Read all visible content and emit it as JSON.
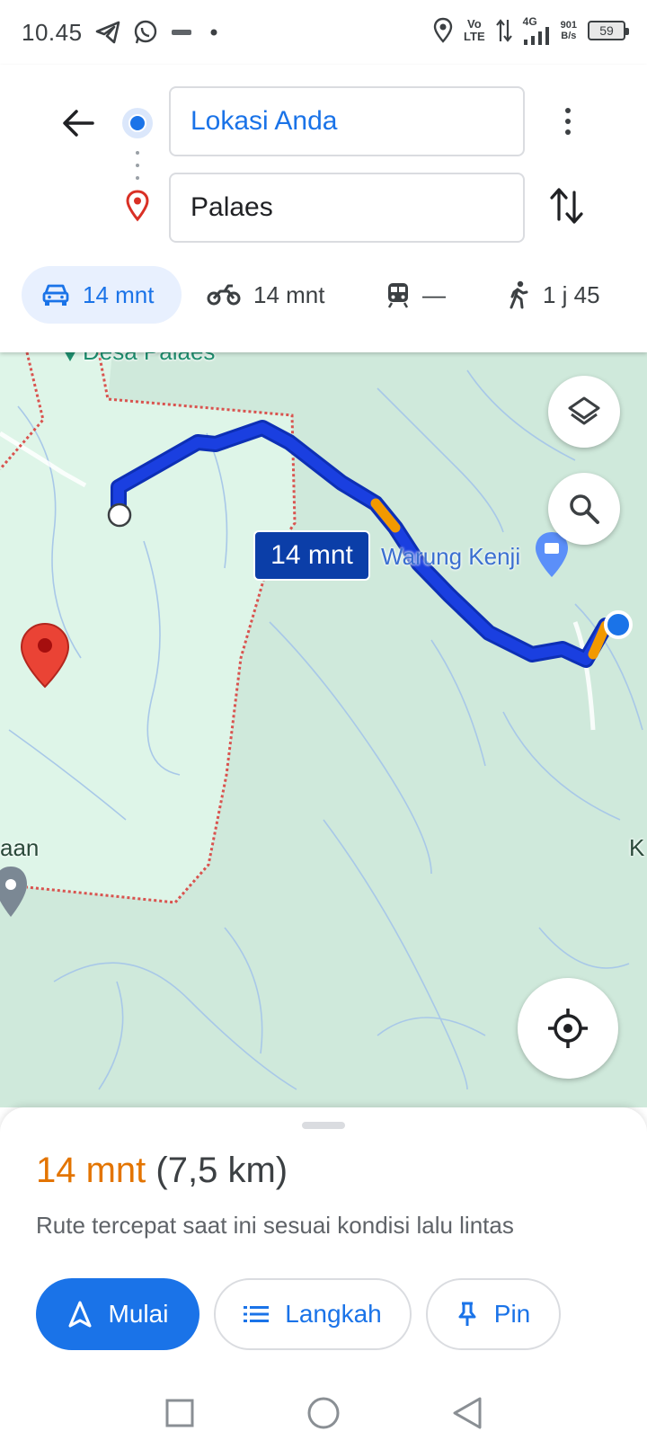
{
  "status_bar": {
    "time": "10.45",
    "network_label_top": "Vo",
    "network_label_bottom": "LTE",
    "network_gen": "4G",
    "speed_value": "901",
    "speed_unit": "B/s",
    "battery": "59",
    "icons": [
      "telegram-icon",
      "whatsapp-icon",
      "app-icon",
      "dot-icon",
      "location-icon",
      "data-arrows-icon",
      "signal-icon"
    ]
  },
  "directions": {
    "origin": "Lokasi Anda",
    "destination": "Palaes"
  },
  "travel_modes": [
    {
      "id": "car",
      "icon": "car-icon",
      "label": "14 mnt",
      "active": true
    },
    {
      "id": "motorcycle",
      "icon": "motorcycle-icon",
      "label": "14 mnt",
      "active": false
    },
    {
      "id": "transit",
      "icon": "train-icon",
      "label": "—",
      "active": false
    },
    {
      "id": "walk",
      "icon": "walk-icon",
      "label": "1 j 45",
      "active": false
    }
  ],
  "map": {
    "village_label": "Desa Palaes",
    "route_time_label": "14 mnt",
    "poi_label": "Warung Kenji",
    "edge_label_left": "aan",
    "edge_label_right": "K",
    "colors": {
      "route": "#1a3fe0",
      "route_traffic": "#f29900",
      "boundary": "#d9534f",
      "land": "#cfe9db",
      "land_light": "#def5e8",
      "destination_pin": "#ea4335"
    }
  },
  "sheet": {
    "duration": "14 mnt",
    "distance": "(7,5 km)",
    "description": "Rute tercepat saat ini sesuai kondisi lalu lintas",
    "start_label": "Mulai",
    "steps_label": "Langkah",
    "pin_label": "Pin"
  },
  "colors": {
    "accent": "#1a73e8",
    "duration_orange": "#e37400"
  }
}
